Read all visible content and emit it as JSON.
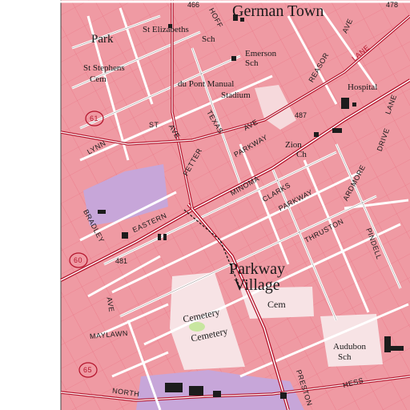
{
  "map": {
    "colors": {
      "urban_tint": "#ef9aa3",
      "street": "#ffffff",
      "street_casing": "#3a2a2a",
      "highway": "#b3122a",
      "grid": "#e54860",
      "park": "#c7a6d9",
      "woodland": "#c8e6a0",
      "building": "#1c1c1c",
      "map_edge": "#ffffff"
    },
    "places": {
      "german_town": "German Town",
      "parkway_village_line1": "Parkway",
      "parkway_village_line2": "Village",
      "park": "Park",
      "st_stephens_line1": "St Stephens",
      "st_stephens_line2": "Cem",
      "st_elizabeths_line1": "St Elizabeths",
      "st_elizabeths_line2": "Sch",
      "emerson_line1": "Emerson",
      "emerson_line2": "Sch",
      "du_pont_line1": "du Pont Manual",
      "du_pont_line2": "Stadium",
      "hospital": "Hospital",
      "zion_line1": "Zion",
      "zion_line2": "Ch",
      "cemetery_1": "Cemetery",
      "cemetery_2": "Cemetery",
      "cem": "Cem",
      "audubon_line1": "Audubon",
      "audubon_line2": "Sch"
    },
    "streets": {
      "hoffman": "HOFF",
      "reasor": "REASOR",
      "ave_reasor": "AVE",
      "lane": "LANE",
      "st": "ST",
      "texas": "TEXAS",
      "ave_texas": "AVE",
      "lynn": "LYNN",
      "fetter": "FETTER",
      "parkway_north": "PARKWAY",
      "ave_north": "AVE",
      "drive": "DRIVE",
      "lane_east": "LANE",
      "ardmore": "ARDMORE",
      "minoma": "MINOMA",
      "clarks": "CLARKS",
      "parkway_mid": "PARKWAY",
      "bradley": "BRADLEY",
      "eastern": "EASTERN",
      "thruston": "THRUSTON",
      "pindell": "PINDELL",
      "ave_west": "AVE",
      "maylawn": "MAYLAWN",
      "north": "NORTH",
      "hess": "HESS",
      "preston": "PRESTON"
    },
    "numbers": {
      "n466": "466",
      "n478": "478",
      "n487": "487",
      "n481": "481",
      "n61": "61",
      "n60": "60",
      "n65": "65"
    }
  }
}
